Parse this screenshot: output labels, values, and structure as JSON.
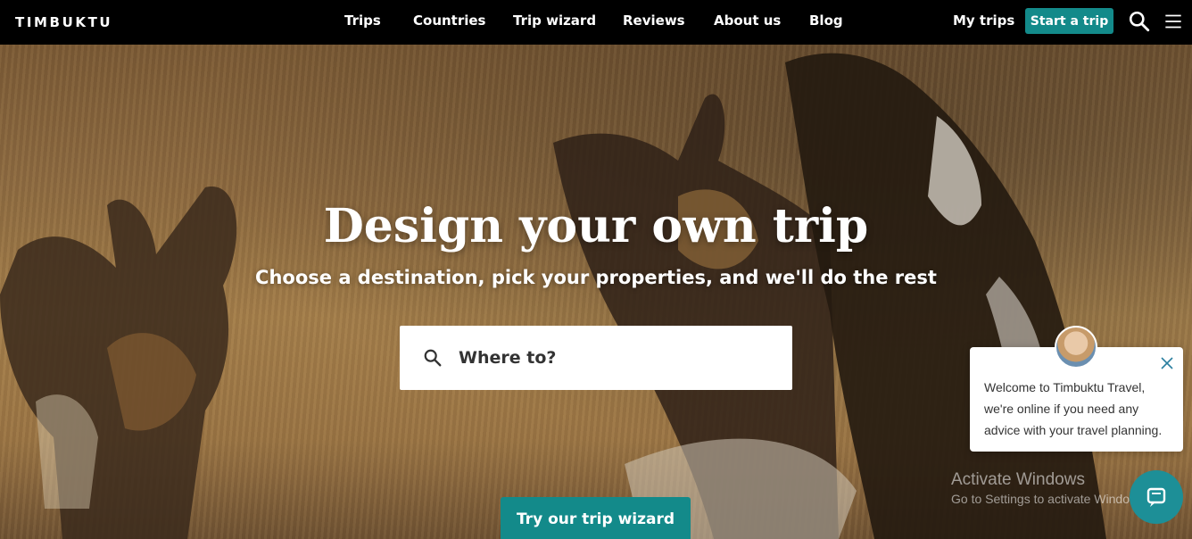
{
  "header": {
    "logo": "TIMBUKTU",
    "nav": [
      "Trips",
      "Countries",
      "Trip wizard",
      "Reviews",
      "About us",
      "Blog"
    ],
    "my_trips": "My trips",
    "start_trip": "Start a trip",
    "accent_color": "#138a8a"
  },
  "hero": {
    "title": "Design your own trip",
    "subtitle": "Choose a destination, pick your properties, and we'll do the rest",
    "search_placeholder": "Where to?",
    "wizard_button": "Try our trip wizard"
  },
  "chat": {
    "message": "Welcome to Timbuktu Travel, we're online if you need any advice with your travel planning."
  },
  "watermark": {
    "title": "Activate Windows",
    "subtitle": "Go to Settings to activate Windows."
  },
  "icons": [
    "search-icon",
    "hamburger-menu-icon",
    "close-icon",
    "chat-bubble-icon"
  ]
}
